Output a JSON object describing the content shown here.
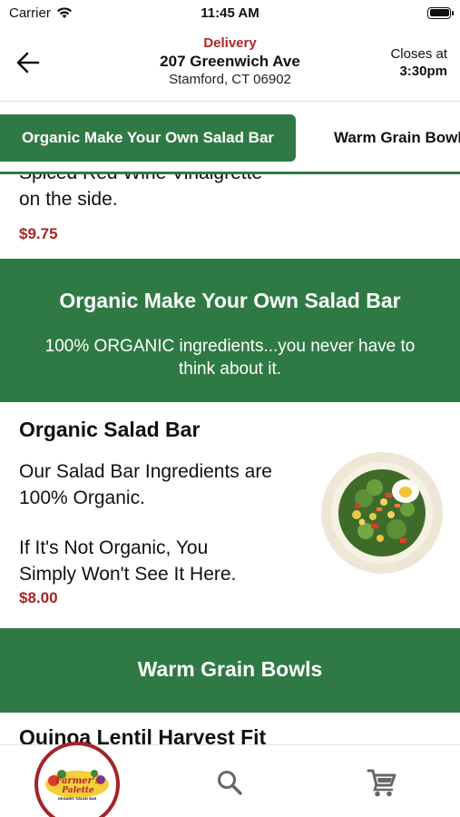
{
  "status_bar": {
    "carrier": "Carrier",
    "time": "11:45 AM"
  },
  "header": {
    "mode": "Delivery",
    "address_line1": "207 Greenwich Ave",
    "address_line2": "Stamford, CT 06902",
    "closes_label": "Closes at",
    "closes_time": "3:30pm"
  },
  "tabs": [
    {
      "label": "Organic Make Your Own Salad Bar",
      "active": true
    },
    {
      "label": "Warm Grain Bowls",
      "active": false
    }
  ],
  "previous_item": {
    "desc_line1": "Spiced Red Wine Vinaigrette",
    "desc_line2": "on the side.",
    "price": "$9.75"
  },
  "sections": [
    {
      "title": "Organic Make Your Own Salad Bar",
      "subtitle_line1": "100% ORGANIC ingredients...you never have to",
      "subtitle_line2": "think about it.",
      "items": [
        {
          "name": "Organic Salad Bar",
          "desc_line1": "Our Salad Bar Ingredients are",
          "desc_line2": "100% Organic.",
          "desc_line3": "If It's Not Organic, You",
          "desc_line4": "Simply Won't See It Here.",
          "price": "$8.00"
        }
      ]
    },
    {
      "title": "Warm Grain Bowls",
      "items": [
        {
          "name": "Quinoa Lentil Harvest Fit"
        }
      ]
    }
  ],
  "bottom_nav": {
    "logo_text_line1": "Farmer's",
    "logo_text_line2": "Palette",
    "logo_tagline": "ORGANIC SALAD BAR"
  },
  "colors": {
    "brand_green": "#2f7a44",
    "price_red": "#a32626",
    "delivery_red": "#b0262a"
  },
  "icons": [
    "wifi-icon",
    "battery-icon",
    "back-arrow-icon",
    "search-icon",
    "cart-icon"
  ]
}
